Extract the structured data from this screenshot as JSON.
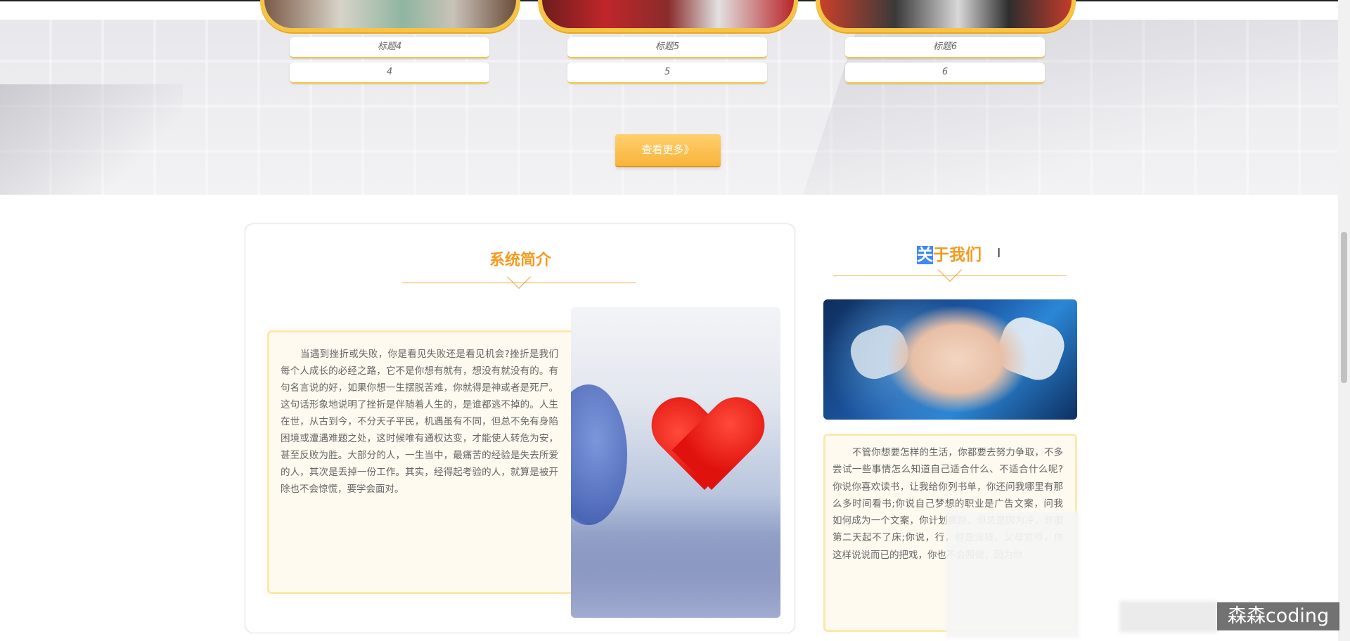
{
  "cards": [
    {
      "title": "标题4",
      "value": "4"
    },
    {
      "title": "标题5",
      "value": "5"
    },
    {
      "title": "标题6",
      "value": "6"
    }
  ],
  "more_button": "查看更多》",
  "intro": {
    "title": "系统简介",
    "text": "当遇到挫折或失败，你是看见失败还是看见机会?挫折是我们每个人成长的必经之路，它不是你想有就有，想没有就没有的。有句名言说的好，如果你想一生摆脱苦难，你就得是神或者是死尸。这句话形象地说明了挫折是伴随着人生的，是谁都逃不掉的。人生在世，从古到今，不分天子平民，机遇虽有不同，但总不免有身陷困境或遭遇难题之处，这时候唯有通权达变，才能使人转危为安，甚至反败为胜。大部分的人，一生当中，最痛苦的经验是失去所爱的人，其次是丢掉一份工作。其实，经得起考验的人，就算是被开除也不会惊慌，要学会面对。"
  },
  "about": {
    "title_highlight": "关",
    "title_rest": "于我们",
    "text": "不管你想要怎样的生活，你都要去努力争取，不多尝试一些事情怎么知道自己适合什么、不适合什么呢? 你说你喜欢读书，让我给你列书单，你还问我哪里有那么多时间看书;你说自己梦想的职业是广告文案，问我如何成为一个文案，你计划晨跑，但总是因为冷，舒服第二天起不了床;你说，行，但是没钱，父母觉得，你这样说说而已的把戏，你也不会照做，因为你"
  },
  "watermark": "森森coding"
}
